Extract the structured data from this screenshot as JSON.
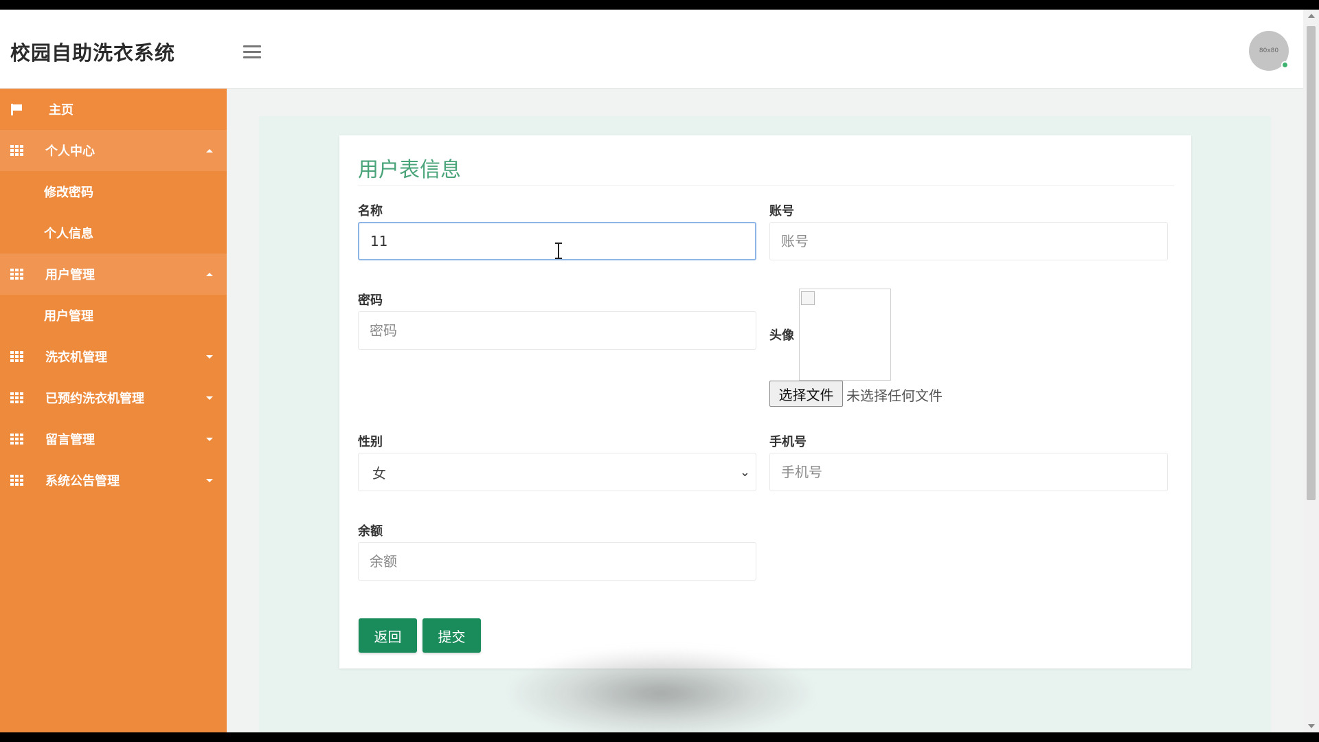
{
  "header": {
    "brand": "校园自助洗衣系统",
    "avatar_text": "80x80"
  },
  "sidebar": {
    "items": [
      {
        "label": "主页",
        "icon": "flag-icon"
      },
      {
        "label": "个人中心",
        "icon": "grid-icon",
        "expanded": true
      },
      {
        "label": "修改密码",
        "sub": true
      },
      {
        "label": "个人信息",
        "sub": true
      },
      {
        "label": "用户管理",
        "icon": "grid-icon",
        "expanded": true
      },
      {
        "label": "用户管理",
        "sub": true
      },
      {
        "label": "洗衣机管理",
        "icon": "grid-icon",
        "expanded": false
      },
      {
        "label": "已预约洗衣机管理",
        "icon": "grid-icon",
        "expanded": false
      },
      {
        "label": "留言管理",
        "icon": "grid-icon",
        "expanded": false
      },
      {
        "label": "系统公告管理",
        "icon": "grid-icon",
        "expanded": false
      }
    ]
  },
  "form": {
    "title": "用户表信息",
    "name": {
      "label": "名称",
      "value": "11"
    },
    "account": {
      "label": "账号",
      "placeholder": "账号"
    },
    "password": {
      "label": "密码",
      "placeholder": "密码"
    },
    "avatar": {
      "label": "头像",
      "file_button": "选择文件",
      "file_status": "未选择任何文件"
    },
    "gender": {
      "label": "性别",
      "value": "女"
    },
    "phone": {
      "label": "手机号",
      "placeholder": "手机号"
    },
    "balance": {
      "label": "余额",
      "placeholder": "余额"
    },
    "back_button": "返回",
    "submit_button": "提交"
  },
  "colors": {
    "sidebar": "#ee8a3c",
    "title": "#4aa47a",
    "button": "#1a8c5b"
  }
}
